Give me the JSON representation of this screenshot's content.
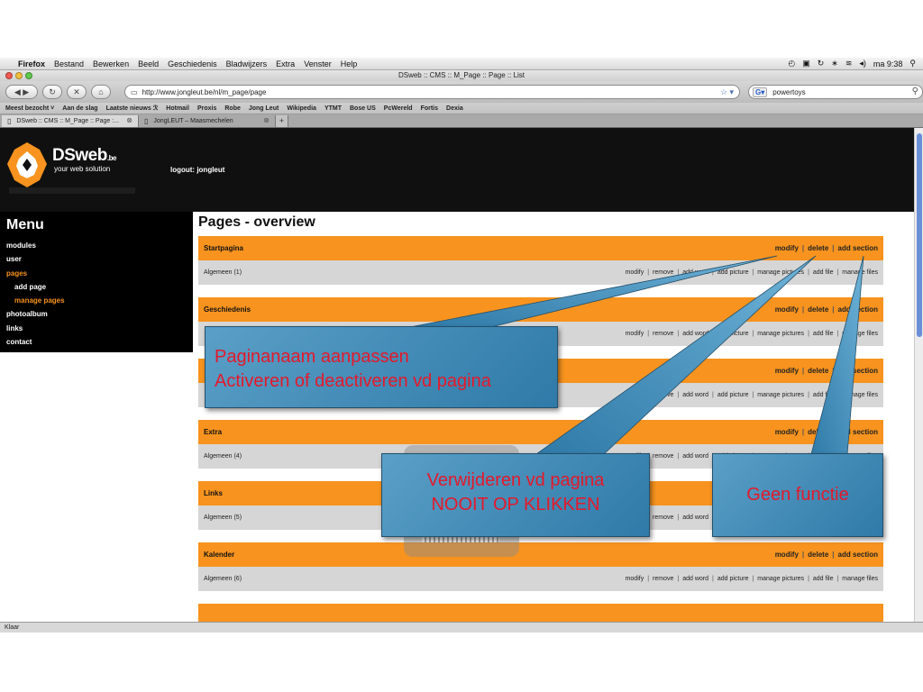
{
  "menubar": {
    "app": "Firefox",
    "items": [
      "Bestand",
      "Bewerken",
      "Beeld",
      "Geschiedenis",
      "Bladwijzers",
      "Extra",
      "Venster",
      "Help"
    ],
    "clock": "ma 9:38"
  },
  "window": {
    "title": "DSweb :: CMS :: M_Page :: Page :: List"
  },
  "toolbar": {
    "url": "http://www.jongleut.be/nl/m_page/page",
    "search_value": "powertoys"
  },
  "bookmarks": [
    "Meest bezocht ˅",
    "Aan de slag",
    "Laatste nieuws ℛ",
    "Hotmail",
    "Proxis",
    "Robe",
    "Jong Leut",
    "Wikipedia",
    "YTMT",
    "Bose US",
    "PcWereld",
    "Fortis",
    "Dexia"
  ],
  "tabs": [
    {
      "label": "DSweb :: CMS :: M_Page :: Page :..."
    },
    {
      "label": "JongLEUT – Maasmechelen"
    }
  ],
  "site": {
    "brand": "DSweb",
    "brand_suffix": ".be",
    "tagline": "your web solution",
    "logout": "logout: jongleut"
  },
  "menu": {
    "title": "Menu",
    "items": [
      {
        "label": "modules"
      },
      {
        "label": "user"
      },
      {
        "label": "pages"
      },
      {
        "label": "add page"
      },
      {
        "label": "manage pages"
      },
      {
        "label": "photoalbum"
      },
      {
        "label": "links"
      },
      {
        "label": "contact"
      }
    ]
  },
  "content": {
    "title": "Pages - overview",
    "head_actions": {
      "modify": "modify",
      "delete": "delete",
      "add_section": "add section"
    },
    "row_actions": {
      "modify": "modify",
      "remove": "remove",
      "add_word": "add word",
      "add_picture": "add picture",
      "manage_pictures": "manage pictures",
      "add_file": "add file",
      "manage_files": "manage files"
    },
    "sections": [
      {
        "name": "Startpagina",
        "row": "Algemeen (1)"
      },
      {
        "name": "Geschiedenis",
        "row": ""
      },
      {
        "name": "",
        "row": ""
      },
      {
        "name": "Extra",
        "row": "Algemeen (4)"
      },
      {
        "name": "Links",
        "row": "Algemeen (5)"
      },
      {
        "name": "Kalender",
        "row": "Algemeen (6)"
      }
    ]
  },
  "status": "Klaar",
  "callouts": {
    "c1": [
      "Paginanaam aanpassen",
      "Activeren of deactiveren vd pagina"
    ],
    "c2": [
      "Verwijderen vd pagina",
      "NOOIT OP KLIKKEN"
    ],
    "c3": [
      "Geen functie"
    ]
  },
  "colors": {
    "orange": "#f7931e",
    "callout_blue": "#3a86b5",
    "callout_text": "#e4192b"
  }
}
